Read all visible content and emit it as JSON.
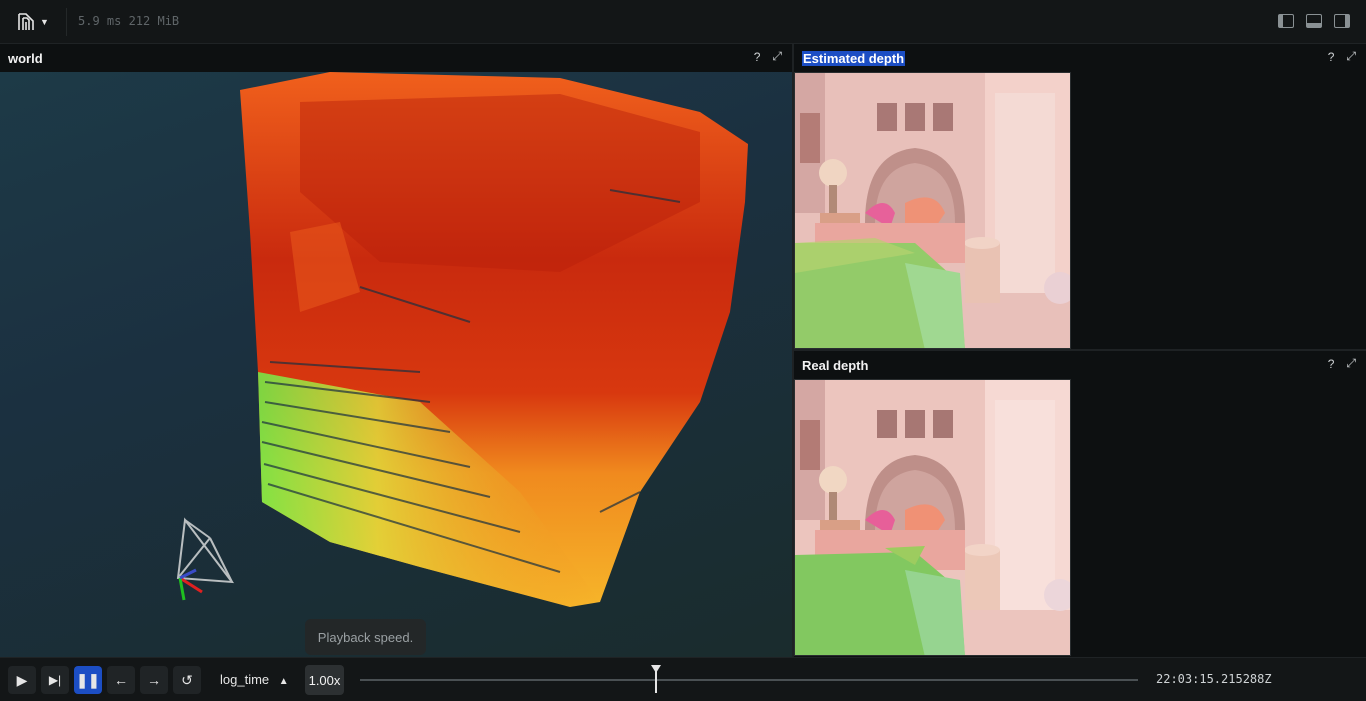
{
  "topbar": {
    "logo_icon": "rerun-logo-icon",
    "stats": "5.9 ms 212 MiB",
    "layout_icons": [
      "left-panel-toggle-icon",
      "bottom-panel-toggle-icon",
      "right-panel-toggle-icon"
    ]
  },
  "panels": {
    "world": {
      "title": "world",
      "help": "?",
      "maximize_icon": "maximize-icon"
    },
    "estimated_depth": {
      "title": "Estimated depth",
      "help": "?",
      "maximize_icon": "maximize-icon"
    },
    "real_depth": {
      "title": "Real depth",
      "help": "?",
      "maximize_icon": "maximize-icon"
    }
  },
  "playback": {
    "buttons": [
      "play-icon",
      "step-forward-icon",
      "pause-icon",
      "arrow-left-icon",
      "arrow-right-icon",
      "loop-icon"
    ],
    "active_button": "pause-icon",
    "timeline": "log_time",
    "timeline_arrow": "▲",
    "speed": "1.00x",
    "tooltip": "Playback speed.",
    "time": "22:03:15.215288Z",
    "progress": 0.38
  },
  "colors": {
    "accent": "#1c4ec4",
    "background": "#0d1011",
    "panel_bar": "#131617"
  }
}
